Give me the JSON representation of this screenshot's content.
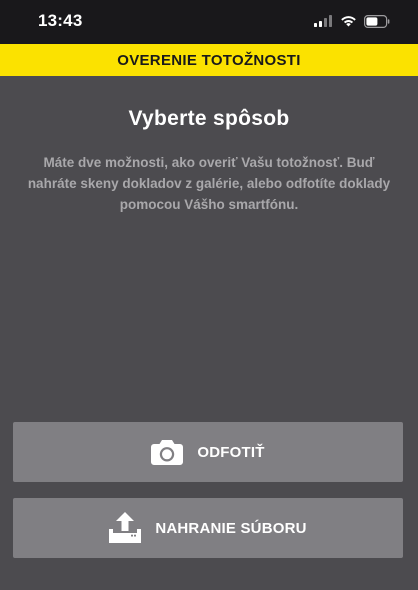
{
  "status_bar": {
    "time": "13:43",
    "icons": [
      "cellular-signal-icon",
      "wifi-icon",
      "battery-icon"
    ]
  },
  "header": {
    "title": "OVERENIE TOTOŽNOSTI",
    "background": "#fbe200"
  },
  "main": {
    "heading": "Vyberte spôsob",
    "description": "Máte dve možnosti, ako overiť Vašu totožnosť. Buď nahráte skeny dokladov z galérie, alebo odfotíte doklady pomocou Vášho smartfónu."
  },
  "actions": {
    "camera": {
      "label": "ODFOTIŤ",
      "icon": "camera-icon"
    },
    "upload": {
      "label": "NAHRANIE SÚBORU",
      "icon": "upload-icon"
    }
  },
  "colors": {
    "background": "#4c4b4f",
    "button": "#807f83",
    "status_bar": "#19181b",
    "accent": "#fbe200"
  }
}
